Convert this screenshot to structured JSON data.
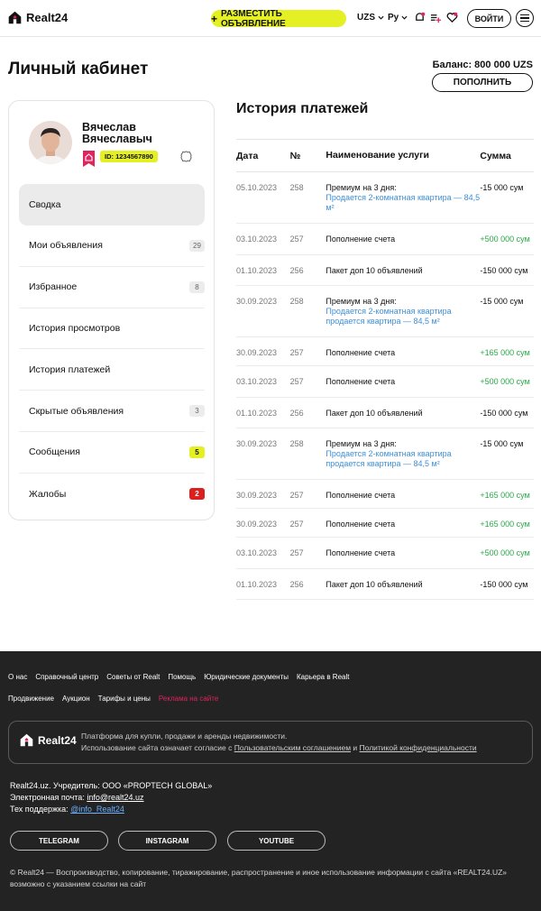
{
  "header": {
    "logo_text": "Realt24",
    "post_button": "РАЗМЕСТИТЬ ОБЪЯВЛЕНИЕ",
    "currency": "UZS",
    "language": "Ру",
    "login_button": "ВОЙТИ",
    "icons": [
      "notifications-icon",
      "compare-icon",
      "favorites-icon",
      "menu-icon"
    ]
  },
  "page": {
    "title": "Личный кабинет",
    "balance": "Баланс: 800 000 UZS",
    "topup_button": "ПОПОЛНИТЬ"
  },
  "profile": {
    "name_line1": "Вячеслав",
    "name_line2": "Вячеславыч",
    "id_badge": "ID: 1234567890"
  },
  "menu": [
    {
      "label": "Сводка",
      "count": "",
      "style": "none"
    },
    {
      "label": "Мои объявления",
      "count": "29",
      "style": "grey"
    },
    {
      "label": "Избранное",
      "count": "8",
      "style": "grey"
    },
    {
      "label": "История просмотров",
      "count": "",
      "style": "none"
    },
    {
      "label": "История платежей",
      "count": "",
      "style": "none"
    },
    {
      "label": "Скрытые объявления",
      "count": "3",
      "style": "grey"
    },
    {
      "label": "Сообщения",
      "count": "5",
      "style": "yellow"
    },
    {
      "label": "Жалобы",
      "count": "2",
      "style": "red"
    }
  ],
  "payments": {
    "title": "История платежей",
    "columns": {
      "date": "Дата",
      "num": "№",
      "name": "Наименование услуги",
      "sum": "Сумма"
    },
    "rows": [
      {
        "date": "05.10.2023",
        "num": "258",
        "name": "Премиум на 3 дня:",
        "link": "Продается 2-комнатная квартира — 84,5 м²",
        "sum": "-15 000 сум",
        "positive": false
      },
      {
        "date": "03.10.2023",
        "num": "257",
        "name": "Пополнение счета",
        "link": "",
        "sum": "+500 000 сум",
        "positive": true
      },
      {
        "date": "01.10.2023",
        "num": "256",
        "name": "Пакет доп 10 объявлений",
        "link": "",
        "sum": "-150 000 сум",
        "positive": false
      },
      {
        "date": "30.09.2023",
        "num": "258",
        "name": "Премиум на 3 дня:",
        "link": "Продается 2-комнатная квартира продается квартира — 84,5 м²",
        "sum": "-15 000 сум",
        "positive": false
      },
      {
        "date": "30.09.2023",
        "num": "257",
        "name": "Пополнение счета",
        "link": "",
        "sum": "+165 000 сум",
        "positive": true
      },
      {
        "date": "03.10.2023",
        "num": "257",
        "name": "Пополнение счета",
        "link": "",
        "sum": "+500 000 сум",
        "positive": true
      },
      {
        "date": "01.10.2023",
        "num": "256",
        "name": "Пакет доп 10 объявлений",
        "link": "",
        "sum": "-150 000 сум",
        "positive": false
      },
      {
        "date": "30.09.2023",
        "num": "258",
        "name": "Премиум на 3 дня:",
        "link": "Продается 2-комнатная квартира продается квартира — 84,5 м²",
        "sum": "-15 000 сум",
        "positive": false
      },
      {
        "date": "30.09.2023",
        "num": "257",
        "name": "Пополнение счета",
        "link": "",
        "sum": "+165 000 сум",
        "positive": true
      },
      {
        "date": "30.09.2023",
        "num": "257",
        "name": "Пополнение счета",
        "link": "",
        "sum": "+165 000 сум",
        "positive": true
      },
      {
        "date": "03.10.2023",
        "num": "257",
        "name": "Пополнение счета",
        "link": "",
        "sum": "+500 000 сум",
        "positive": true
      },
      {
        "date": "01.10.2023",
        "num": "256",
        "name": "Пакет доп 10 объявлений",
        "link": "",
        "sum": "-150 000 сум",
        "positive": false
      }
    ]
  },
  "footer": {
    "links_row1": [
      "О нас",
      "Справочный центр",
      "Советы от Realt",
      "Помощь",
      "Юридические документы",
      "Карьера в Realt"
    ],
    "links_row2": [
      "Продвижение",
      "Аукцион",
      "Тарифы и цены"
    ],
    "promo_link": "Реклама на сайте",
    "logo_text": "Realt24",
    "box_line1": "Платформа для купли, продажи и аренды недвижимости.",
    "box_line2_prefix": "Использование сайта означает согласие с",
    "box_link1": "Пользовательским соглашением",
    "box_and": "и",
    "box_link2": "Политикой конфиденциальности",
    "info_line1": "Realt24.uz. Учредитель: ООО «PROPTECH GLOBAL»",
    "email_label": "Электронная почта:",
    "email": "info@realt24.uz",
    "support_label": "Тех поддержка:",
    "support": "@info_Realt24",
    "social": [
      "TELEGRAM",
      "INSTAGRAM",
      "YOUTUBE"
    ],
    "copyright": "© Realt24 — Воспроизводство, копирование, тиражирование, распространение и иное использование информации с сайта «REALT24.UZ» возможно с указанием ссылки на сайт"
  },
  "colors": {
    "accent_yellow": "#e4f023",
    "brand_pink": "#e0245e",
    "positive_green": "#2ba84a",
    "link_blue": "#3d8fd8",
    "danger_red": "#d9211f",
    "footer_bg": "#232323"
  }
}
